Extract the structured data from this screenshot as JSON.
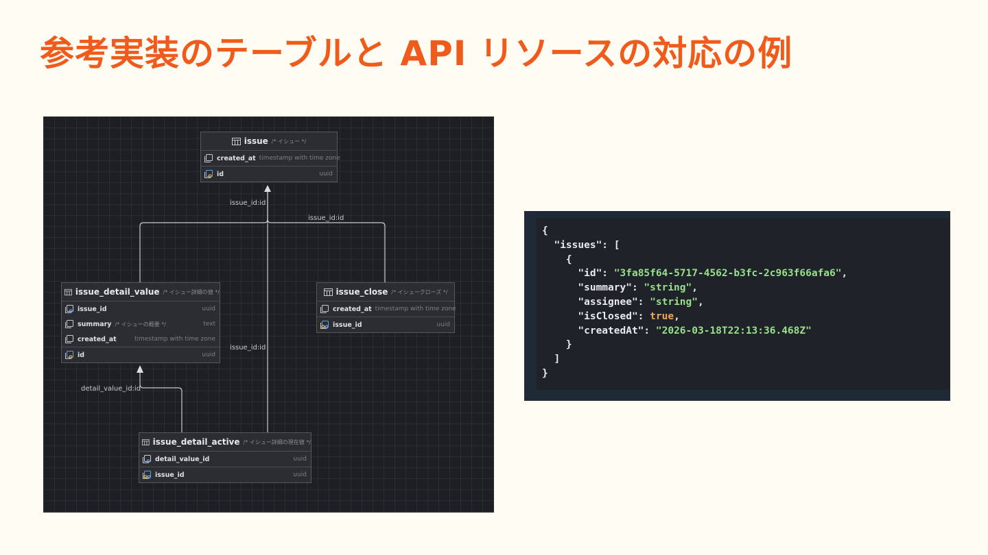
{
  "title": "参考実装のテーブルと API リソースの対応の例",
  "erd": {
    "entities": {
      "issue": {
        "name": "issue",
        "comment": "/* イシュー */",
        "columns": [
          {
            "name": "created_at",
            "comment": "",
            "type": "timestamp with time zone",
            "icon": "column-icon"
          },
          {
            "name": "id",
            "comment": "",
            "type": "uuid",
            "icon": "primary-key-column-icon"
          }
        ]
      },
      "issue_detail_value": {
        "name": "issue_detail_value",
        "comment": "/* イシュー詳細の値 */",
        "columns": [
          {
            "name": "issue_id",
            "comment": "",
            "type": "uuid",
            "icon": "foreign-key-column-icon"
          },
          {
            "name": "summary",
            "comment": "/* イシューの概要 */",
            "type": "text",
            "icon": "column-icon"
          },
          {
            "name": "created_at",
            "comment": "",
            "type": "timestamp with time zone",
            "icon": "column-icon"
          },
          {
            "name": "id",
            "comment": "",
            "type": "uuid",
            "icon": "primary-key-column-icon"
          }
        ]
      },
      "issue_close": {
        "name": "issue_close",
        "comment": "/* イシュークローズ */",
        "columns": [
          {
            "name": "created_at",
            "comment": "",
            "type": "timestamp with time zone",
            "icon": "column-icon"
          },
          {
            "name": "issue_id",
            "comment": "",
            "type": "uuid",
            "icon": "primary-foreign-key-column-icon"
          }
        ]
      },
      "issue_detail_active": {
        "name": "issue_detail_active",
        "comment": "/* イシュー詳細の現在値 */",
        "columns": [
          {
            "name": "detail_value_id",
            "comment": "",
            "type": "uuid",
            "icon": "foreign-key-column-icon"
          },
          {
            "name": "issue_id",
            "comment": "",
            "type": "uuid",
            "icon": "primary-foreign-key-column-icon"
          }
        ]
      }
    },
    "relations": [
      {
        "label": "issue_id:id",
        "from": "issue_detail_value",
        "to": "issue"
      },
      {
        "label": "issue_id:id",
        "from": "issue_close",
        "to": "issue"
      },
      {
        "label": "issue_id:id",
        "from": "issue_detail_active",
        "to": "issue"
      },
      {
        "label": "detail_value_id:id",
        "from": "issue_detail_active",
        "to": "issue_detail_value"
      }
    ]
  },
  "json_example": {
    "id": "3fa85f64-5717-4562-b3fc-2c963f66afa6",
    "summary": "string",
    "assignee": "string",
    "isClosed": "true",
    "createdAt": "2026-03-18T22:13:36.468Z"
  },
  "colors": {
    "title": "#f05a1a",
    "slide_background": "#fffcf3",
    "erd_background": "#1e1f22",
    "json_background": "#1f2329",
    "json_string": "#98e08a",
    "json_boolean": "#f0a35a"
  }
}
